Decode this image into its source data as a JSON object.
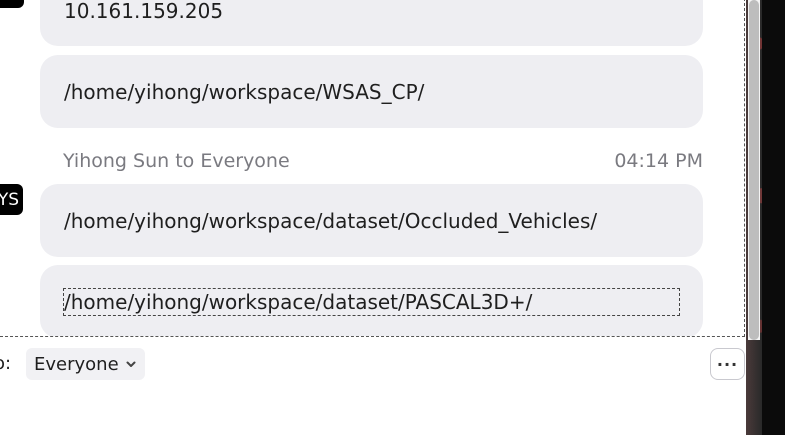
{
  "messages": [
    {
      "text": "10.161.159.205"
    },
    {
      "text": "/home/yihong/workspace/WSAS_CP/"
    },
    {
      "text": "/home/yihong/workspace/dataset/Occluded_Vehicles/"
    },
    {
      "text": "/home/yihong/workspace/dataset/PASCAL3D+/"
    }
  ],
  "sender": {
    "line": "Yihong Sun to Everyone",
    "time": "04:14 PM",
    "avatar_initials": "YS"
  },
  "composer": {
    "to_label": "o:",
    "recipient": "Everyone",
    "more_label": "···"
  },
  "icons": {
    "recipient_chevron": "chevron-down-icon",
    "more": "more-options-icon"
  },
  "colors": {
    "bubble_bg": "#eeeef2",
    "meta_text": "#7a7a80",
    "avatar_bg": "#000000"
  }
}
